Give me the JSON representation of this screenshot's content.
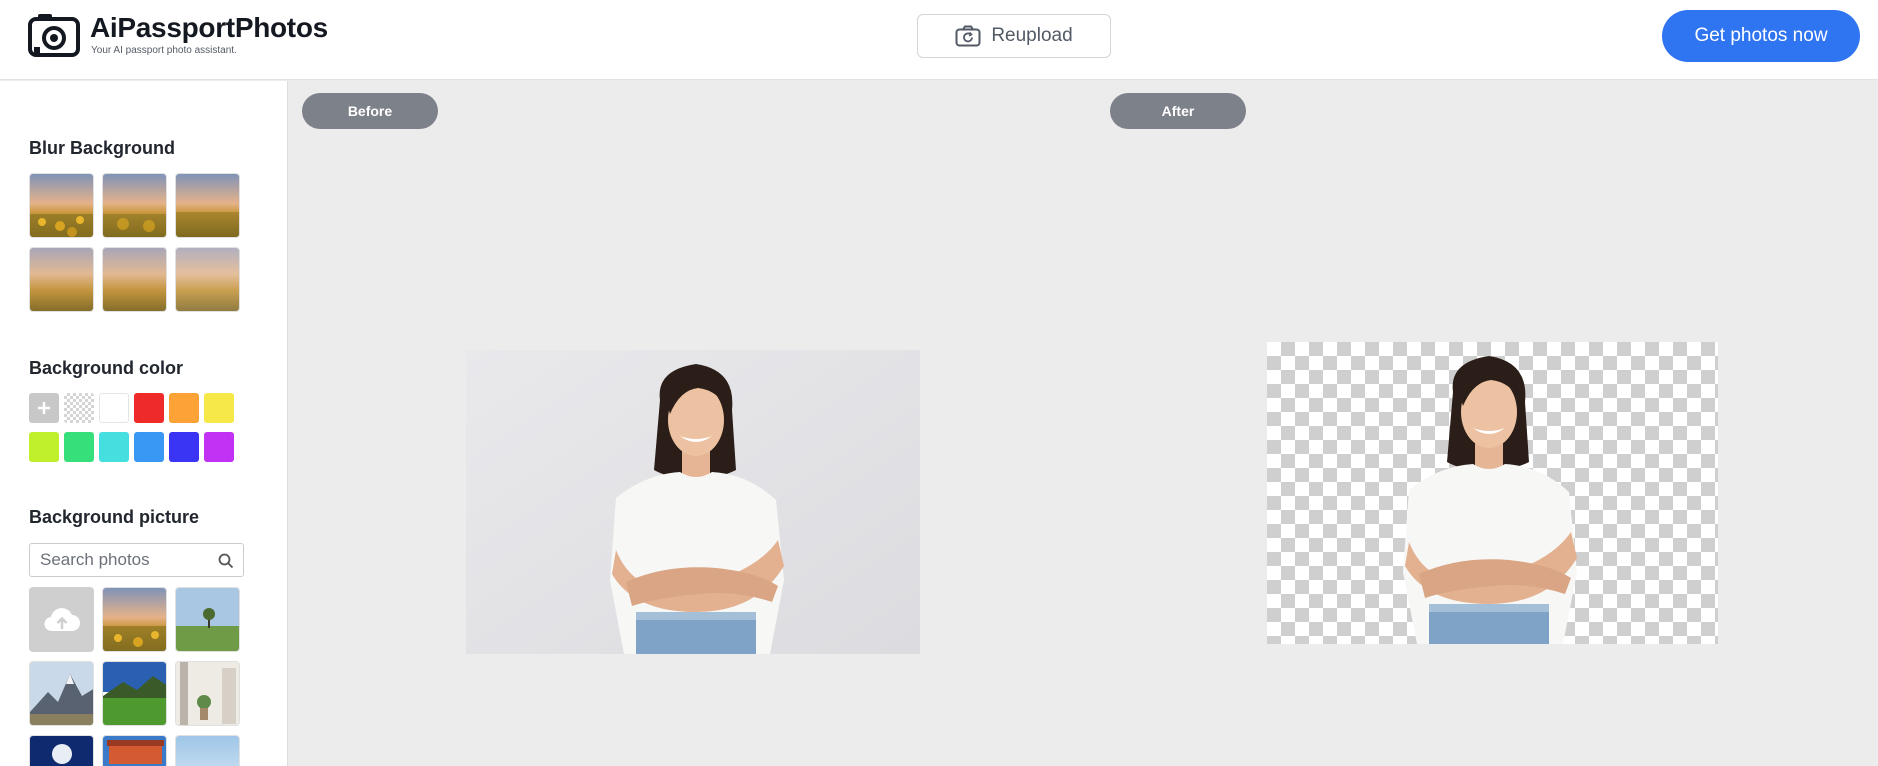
{
  "header": {
    "brand": "AiPassportPhotos",
    "tagline": "Your AI passport photo assistant.",
    "reupload_label": "Reupload",
    "get_photos_label": "Get photos now"
  },
  "sidebar": {
    "blur_title": "Blur Background",
    "blur_levels": [
      "blur-0",
      "blur-1",
      "blur-2",
      "blur-3",
      "blur-4",
      "blur-5"
    ],
    "color_title": "Background color",
    "colors": [
      "add-custom",
      "transparent",
      "#ffffff",
      "#ee2a2a",
      "#fca236",
      "#f7e84a",
      "#c0ef2c",
      "#37df7a",
      "#45dfe0",
      "#3a98f5",
      "#3a35f5",
      "#c132f5"
    ],
    "picture_title": "Background picture",
    "search_placeholder": "Search photos",
    "pictures": [
      "upload-icon",
      "sunset-field",
      "lone-tree",
      "mountain-peak",
      "green-hills",
      "white-room",
      "moon-night",
      "building",
      "sky"
    ]
  },
  "main": {
    "before_label": "Before",
    "after_label": "After"
  },
  "colors": {
    "accent": "#2f74f0",
    "pill": "#7d818a",
    "canvas_bg": "#ececec"
  }
}
